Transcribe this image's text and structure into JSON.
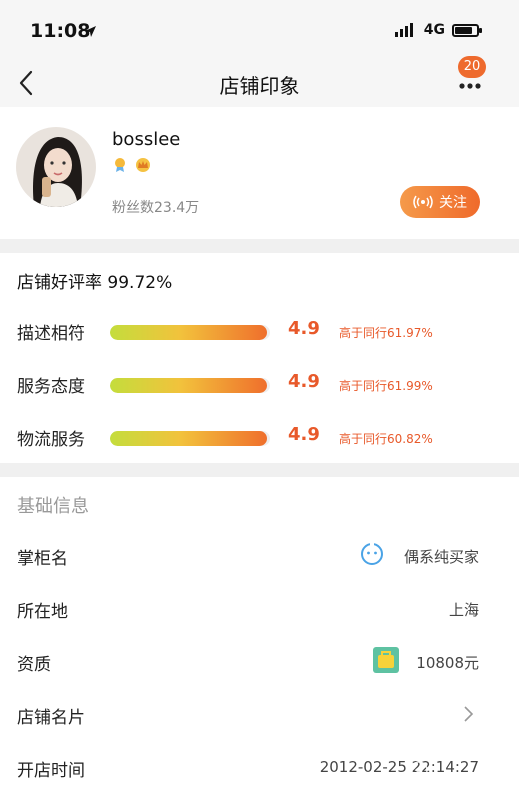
{
  "status_bar": {
    "time": "11:08",
    "network": "4G"
  },
  "nav": {
    "title": "店铺印象",
    "badge_count": "20"
  },
  "profile": {
    "name": "bosslee",
    "fans": "粉丝数23.4万",
    "follow_label": "关注"
  },
  "ratings": {
    "overall": "店铺好评率 99.72%",
    "items": [
      {
        "label": "描述相符",
        "score": "4.9",
        "compare": "高于同行61.97%",
        "fill": 0.98
      },
      {
        "label": "服务态度",
        "score": "4.9",
        "compare": "高于同行61.99%",
        "fill": 0.98
      },
      {
        "label": "物流服务",
        "score": "4.9",
        "compare": "高于同行60.82%",
        "fill": 0.98
      }
    ]
  },
  "basic_info": {
    "title": "基础信息",
    "rows": [
      {
        "label": "掌柜名",
        "value": "偶系纯买家"
      },
      {
        "label": "所在地",
        "value": "上海"
      },
      {
        "label": "资质",
        "value": "10808元"
      },
      {
        "label": "店铺名片",
        "value": ""
      },
      {
        "label": "开店时间",
        "value": "2012-02-25 22:14:27"
      }
    ]
  },
  "colors": {
    "accent": "#ee6a2d",
    "score": "#e8592a"
  }
}
